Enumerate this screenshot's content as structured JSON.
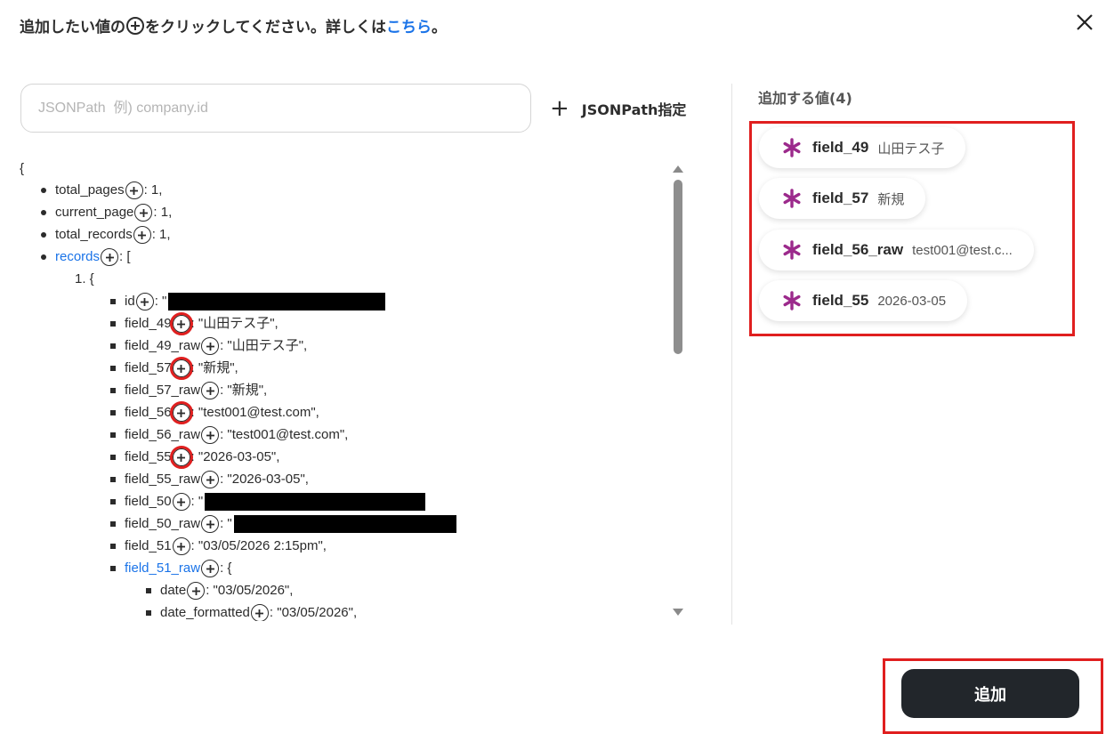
{
  "header": {
    "instruction_before": "追加したい値の",
    "instruction_after": "をクリックしてください。詳しくは",
    "link_text": "こちら",
    "instruction_end": "。"
  },
  "search": {
    "placeholder": "JSONPath  例) company.id"
  },
  "jsonpath_button": {
    "label": "JSONPath指定"
  },
  "tree": {
    "open_brace": "{",
    "lines": [
      {
        "key": "total_pages",
        "suffix": ": 1,",
        "level": 1
      },
      {
        "key": "current_page",
        "suffix": ": 1,",
        "level": 1
      },
      {
        "key": "total_records",
        "suffix": ": 1,",
        "level": 1
      },
      {
        "key": "records",
        "suffix": ": [",
        "level": 1,
        "link": true
      },
      {
        "key": "1. {",
        "level": 2,
        "plain": true
      },
      {
        "key": "id",
        "suffix": ": \"",
        "level": 3,
        "redacted": true
      },
      {
        "key": "field_49",
        "suffix": ": \"山田テス子\",",
        "level": 3,
        "highlighted": true
      },
      {
        "key": "field_49_raw",
        "suffix": ": \"山田テス子\",",
        "level": 3
      },
      {
        "key": "field_57",
        "suffix": ": \"新規\",",
        "level": 3,
        "highlighted": true
      },
      {
        "key": "field_57_raw",
        "suffix": ": \"新規\",",
        "level": 3
      },
      {
        "key": "field_56",
        "suffix": ": \"test001@test.com\",",
        "level": 3,
        "highlighted": true
      },
      {
        "key": "field_56_raw",
        "suffix": ": \"test001@test.com\",",
        "level": 3
      },
      {
        "key": "field_55",
        "suffix": ": \"2026-03-05\",",
        "level": 3,
        "highlighted": true
      },
      {
        "key": "field_55_raw",
        "suffix": ": \"2026-03-05\",",
        "level": 3
      },
      {
        "key": "field_50",
        "suffix": ": \"",
        "level": 3,
        "redacted": true
      },
      {
        "key": "field_50_raw",
        "suffix": ": \"",
        "level": 3,
        "redacted": true
      },
      {
        "key": "field_51",
        "suffix": ": \"03/05/2026 2:15pm\",",
        "level": 3
      },
      {
        "key": "field_51_raw",
        "suffix": ": {",
        "level": 3,
        "link": true
      },
      {
        "key": "date",
        "suffix": ": \"03/05/2026\",",
        "level": 4
      },
      {
        "key": "date_formatted",
        "suffix": ": \"03/05/2026\",",
        "level": 4
      }
    ]
  },
  "added_panel": {
    "title": "追加する値(4)",
    "chips": [
      {
        "key": "field_49",
        "value": "山田テス子"
      },
      {
        "key": "field_57",
        "value": "新規"
      },
      {
        "key": "field_56_raw",
        "value": "test001@test.c..."
      },
      {
        "key": "field_55",
        "value": "2026-03-05"
      }
    ]
  },
  "colors": {
    "accent_link": "#1a73e8",
    "highlight": "#e01f1f",
    "chip_star": "#9c2a8c",
    "primary_button": "#22262b"
  },
  "footer": {
    "add_label": "追加"
  }
}
